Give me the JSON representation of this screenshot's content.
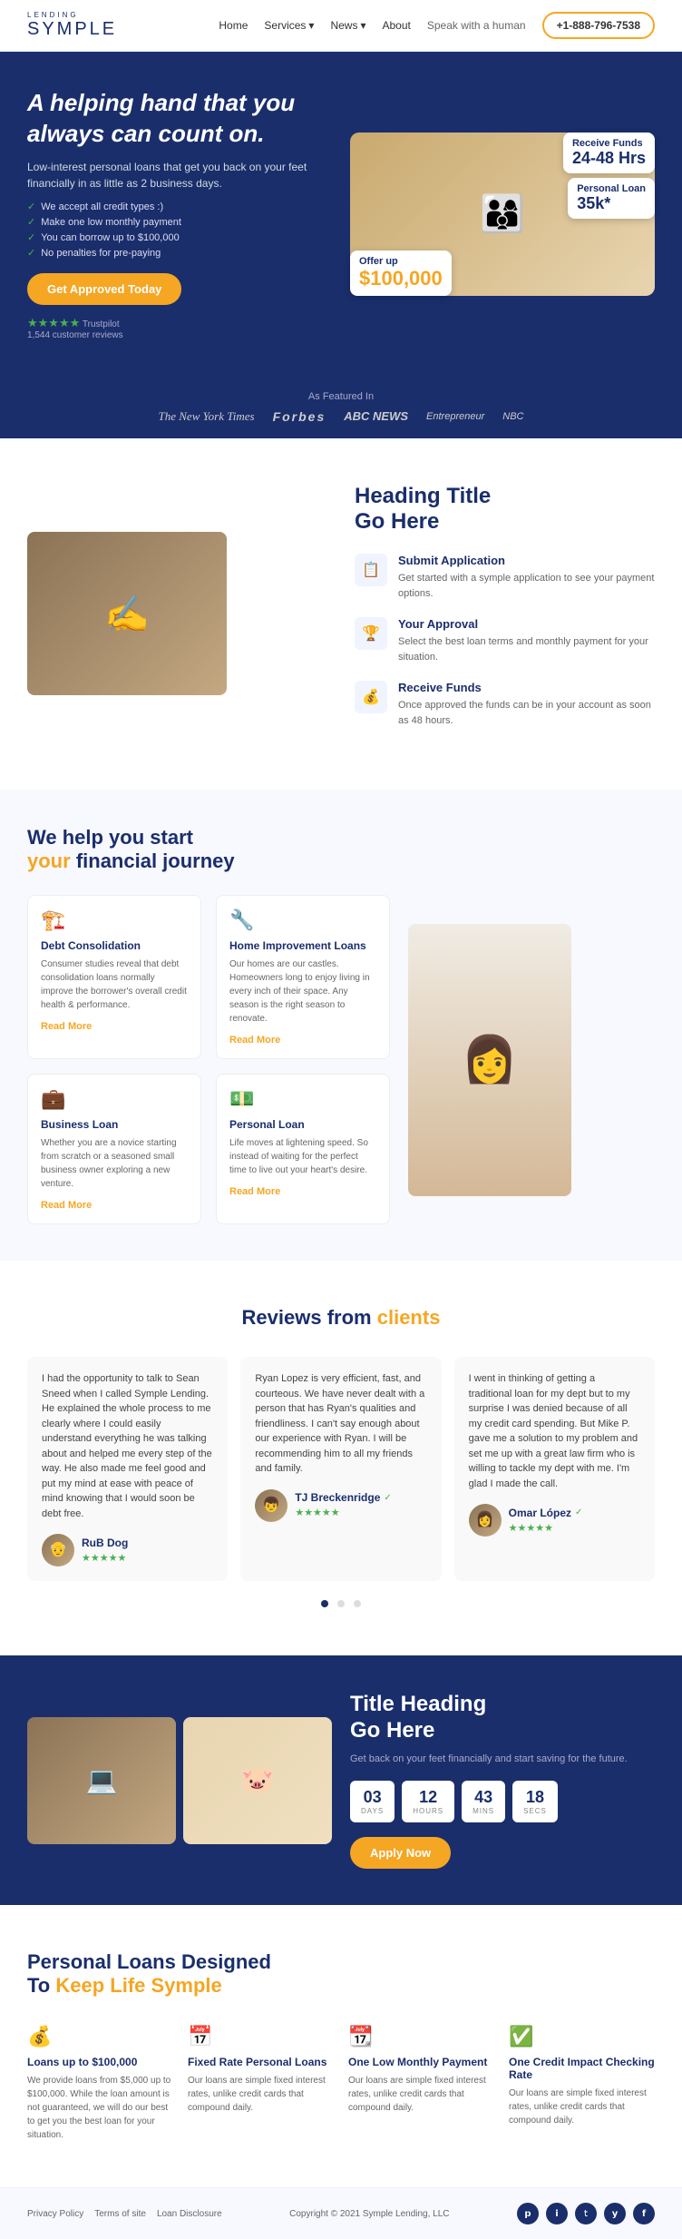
{
  "nav": {
    "logo_line1": "SYMPLE",
    "logo_line2": "LENDING",
    "links": [
      "Home",
      "Services",
      "News",
      "About"
    ],
    "services_dropdown": true,
    "news_dropdown": true,
    "speak_label": "Speak with a human",
    "phone": "+1-888-796-7538"
  },
  "hero": {
    "heading_part1": "A helping hand that you always can ",
    "heading_emphasis": "count on.",
    "subheading": "Low-interest personal loans that get you back on your feet financially in as little as 2 business days.",
    "checklist": [
      "We accept all credit types :)",
      "Make one low monthly payment",
      "You can borrow up to $100,000",
      "No penalties for pre-paying"
    ],
    "cta_label": "Get Approved Today",
    "trustpilot_label": "Trustpilot",
    "review_count": "1,544 customer reviews",
    "badge1_title": "Receive Funds",
    "badge1_value": "24-48 Hrs",
    "badge2_title": "Personal Loan",
    "badge2_value": "35k*",
    "badge3_title": "Offer up",
    "badge3_value": "$100,000"
  },
  "featured": {
    "label": "As Featured In",
    "logos": [
      "The New York Times",
      "Forbes",
      "ABC NEWS",
      "Entrepreneur",
      "NBC"
    ]
  },
  "how_it_works": {
    "heading_part1": "Heading Title",
    "heading_part2": "Go Here",
    "steps": [
      {
        "icon": "📋",
        "title": "Submit Application",
        "desc": "Get started with a symple application to see your payment options."
      },
      {
        "icon": "🏆",
        "title": "Your Approval",
        "desc": "Select the best loan terms and monthly payment for your situation."
      },
      {
        "icon": "💰",
        "title": "Receive Funds",
        "desc": "Once approved the funds can be in your account as soon as 48 hours."
      }
    ]
  },
  "journey": {
    "heading_part1": "We help you start",
    "heading_emphasis": "your",
    "heading_part2": "financial journey",
    "cards": [
      {
        "icon": "🏗️",
        "title": "Debt Consolidation",
        "desc": "Consumer studies reveal that debt consolidation loans normally improve the borrower's overall credit health & performance.",
        "link": "Read More"
      },
      {
        "icon": "🔧",
        "title": "Home Improvement Loans",
        "desc": "Our homes are our castles. Homeowners long to enjoy living in every inch of their space. Any season is the right season to renovate.",
        "link": "Read More"
      },
      {
        "icon": "💼",
        "title": "Business Loan",
        "desc": "Whether you are a novice starting from scratch or a seasoned small business owner exploring a new venture.",
        "link": "Read More"
      },
      {
        "icon": "💵",
        "title": "Personal Loan",
        "desc": "Life moves at lightening speed. So instead of waiting for the perfect time to live out your heart's desire.",
        "link": "Read More"
      }
    ]
  },
  "reviews": {
    "heading_part1": "Reviews from",
    "heading_emphasis": "clients",
    "items": [
      {
        "text": "I had the opportunity to talk to Sean Sneed when I called Symple Lending. He explained the whole process to me clearly where I could easily understand everything he was talking about and helped me every step of the way. He also made me feel good and put my mind at ease with peace of mind knowing that I would soon be debt free.",
        "name": "RuB Dog",
        "verified": true
      },
      {
        "text": "Ryan Lopez is very efficient, fast, and courteous. We have never dealt with a person that has Ryan's qualities and friendliness. I can't say enough about our experience with Ryan. I will be recommending him to all my friends and family.",
        "name": "TJ Breckenridge",
        "verified": true
      },
      {
        "text": "I went in thinking of getting a traditional loan for my dept but to my surprise I was denied because of all my credit card spending. But Mike P. gave me a solution to my problem and set me up with a great law firm who is willing to tackle my dept with me. I'm glad I made the call.",
        "name": "Omar López",
        "verified": true
      }
    ]
  },
  "cta": {
    "heading_part1": "Title Heading",
    "heading_part2": "Go Here",
    "subtext": "Get back on your feet financially and start saving for the future.",
    "countdown": {
      "days": "03",
      "hours": "12",
      "mins": "43",
      "secs": "18"
    },
    "cta_label": "Apply Now"
  },
  "personal_loans": {
    "heading_part1": "Personal Loans Designed",
    "heading_part2": "To",
    "heading_emphasis": "Keep Life Symple",
    "cards": [
      {
        "icon": "💰",
        "title": "Loans up to $100,000",
        "desc": "We provide loans from $5,000 up to $100,000. While the loan amount is not guaranteed, we will do our best to get you the best loan for your situation."
      },
      {
        "icon": "📅",
        "title": "Fixed Rate Personal Loans",
        "desc": "Our loans are simple fixed interest rates, unlike credit cards that compound daily."
      },
      {
        "icon": "📆",
        "title": "One Low Monthly Payment",
        "desc": "Our loans are simple fixed interest rates, unlike credit cards that compound daily."
      },
      {
        "icon": "✅",
        "title": "One Credit Impact Checking Rate",
        "desc": "Our loans are simple fixed interest rates, unlike credit cards that compound daily."
      }
    ]
  },
  "footer": {
    "links": [
      "Privacy Policy",
      "Terms of site",
      "Loan Disclosure"
    ],
    "copyright": "Copyright © 2021 Symple Lending, LLC",
    "social": [
      "p",
      "i",
      "t",
      "y",
      "f"
    ]
  }
}
